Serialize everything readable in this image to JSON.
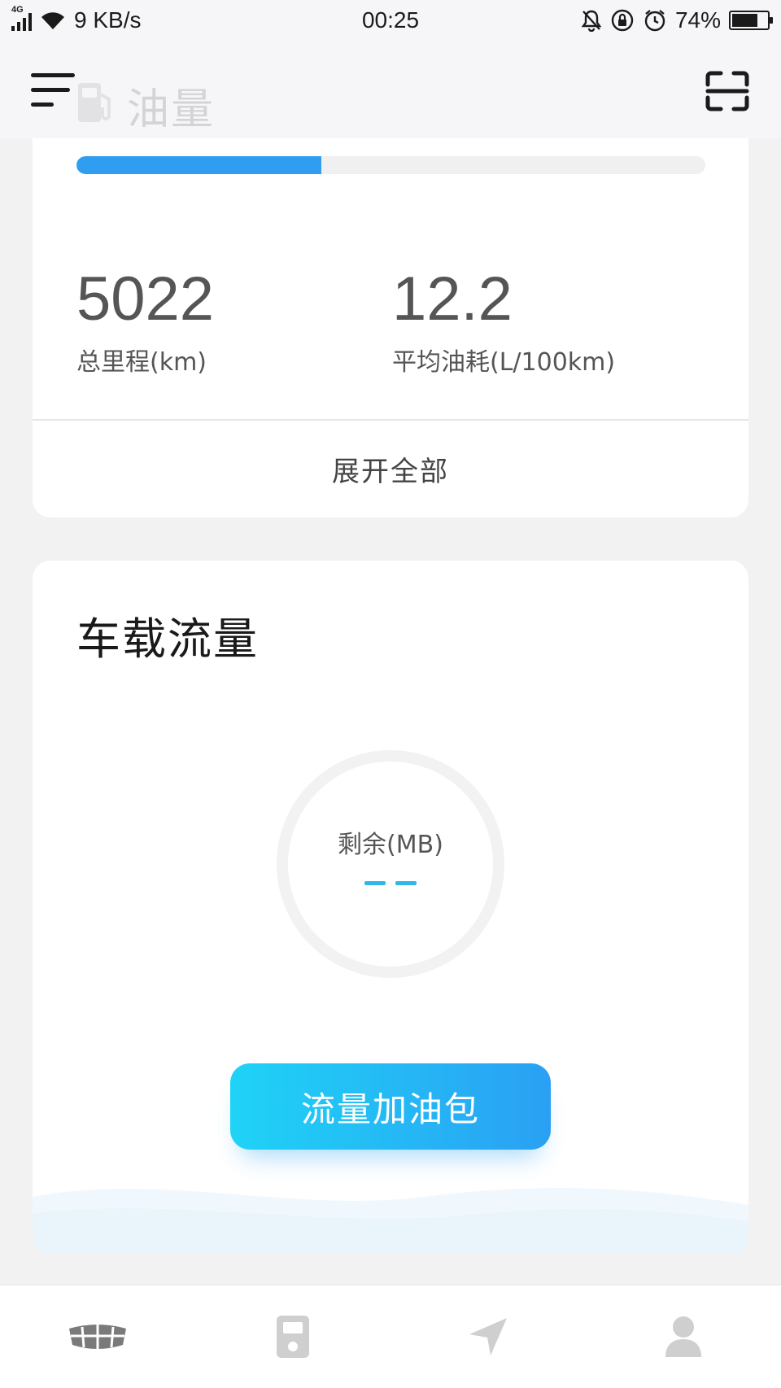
{
  "status_bar": {
    "network_type": "4G",
    "speed": "9 KB/s",
    "time": "00:25",
    "battery": "74%",
    "battery_level": 0.74
  },
  "header": {
    "title": "油量",
    "icons": [
      "menu-icon",
      "fuel-pump-icon",
      "scan-icon"
    ]
  },
  "fuel_card": {
    "progress_fraction": 0.39,
    "stats": [
      {
        "value": "5022",
        "label": "总里程(km)"
      },
      {
        "value": "12.2",
        "label": "平均油耗(L/100km)"
      }
    ],
    "expand_label": "展开全部"
  },
  "data_card": {
    "title": "车载流量",
    "remaining_label": "剩余(MB)",
    "remaining_value": "--",
    "buy_button_label": "流量加油包"
  },
  "bottom_nav": {
    "items": [
      "car-grille-icon",
      "fuel-station-icon",
      "navigation-icon",
      "profile-icon"
    ]
  },
  "colors": {
    "progress": "#2f9df0",
    "button_start": "#1fd3f6",
    "button_end": "#2aa0f4",
    "ring_value": "#31b8ea"
  }
}
